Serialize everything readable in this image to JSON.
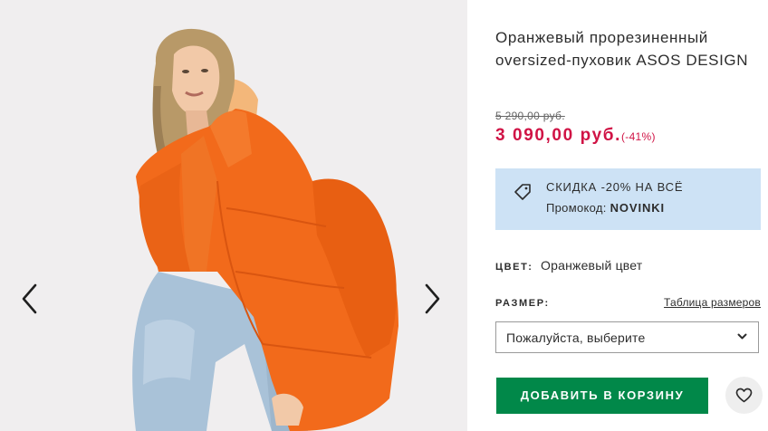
{
  "product": {
    "title": "Оранжевый прорезиненный oversized-пуховик ASOS DESIGN",
    "old_price": "5 290,00 руб.",
    "new_price": "3 090,00 руб.",
    "discount": "(-41%)"
  },
  "promo": {
    "headline": "СКИДКА -20% НА ВСЁ",
    "code_label": "Промокод:",
    "code": "NOVINKI",
    "background": "#cde2f5",
    "icon": "price-tag-icon"
  },
  "color": {
    "label": "ЦВЕТ:",
    "value": "Оранжевый цвет"
  },
  "size": {
    "label": "РАЗМЕР:",
    "guide_link": "Таблица размеров",
    "select_placeholder": "Пожалуйста, выберите"
  },
  "actions": {
    "add_to_bag": "ДОБАВИТЬ В КОРЗИНУ",
    "wishlist_icon": "heart-icon"
  },
  "gallery": {
    "prev_icon": "chevron-left-icon",
    "next_icon": "chevron-right-icon"
  },
  "colors": {
    "accent_price": "#d01345",
    "button_green": "#018849",
    "jacket_orange": "#f26a1b"
  }
}
